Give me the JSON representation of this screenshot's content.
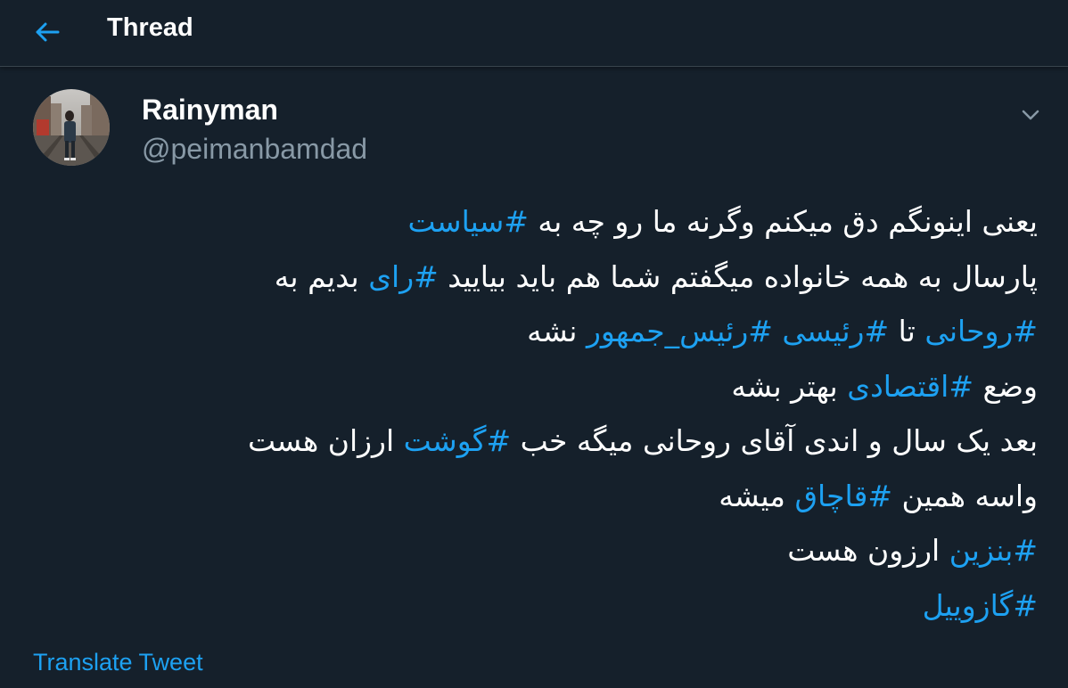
{
  "header": {
    "title": "Thread",
    "back_icon": "arrow-left-icon"
  },
  "tweet": {
    "author": {
      "display_name": "Rainyman",
      "handle": "@peimanbamdad"
    },
    "lines": [
      [
        {
          "t": "یعنی اینونگم دق میکنم وگرنه ما رو چه به "
        },
        {
          "t": "#سیاست",
          "tag": true
        }
      ],
      [
        {
          "t": "پارسال به همه خانواده میگفتم شما هم باید بیایید "
        },
        {
          "t": "#رای",
          "tag": true
        },
        {
          "t": " بدیم به"
        }
      ],
      [
        {
          "t": "#روحانی",
          "tag": true
        },
        {
          "t": " تا "
        },
        {
          "t": "#رئیسی",
          "tag": true
        },
        {
          "t": " "
        },
        {
          "t": "#رئیس_جمهور",
          "tag": true
        },
        {
          "t": " نشه"
        }
      ],
      [
        {
          "t": "وضع "
        },
        {
          "t": "#اقتصادی",
          "tag": true
        },
        {
          "t": " بهتر بشه"
        }
      ],
      [
        {
          "t": "بعد یک سال و اندی آقای روحانی میگه خب "
        },
        {
          "t": "#گوشت",
          "tag": true
        },
        {
          "t": " ارزان هست"
        }
      ],
      [
        {
          "t": "واسه همین "
        },
        {
          "t": "#قاچاق",
          "tag": true
        },
        {
          "t": " میشه"
        }
      ],
      [
        {
          "t": "#بنزین",
          "tag": true
        },
        {
          "t": " ارزون هست"
        }
      ],
      [
        {
          "t": "#گازوییل",
          "tag": true
        }
      ]
    ],
    "translate_label": "Translate Tweet"
  },
  "colors": {
    "background": "#15202b",
    "accent": "#1da1f2",
    "secondary_text": "#8899a6",
    "border": "#38444d"
  },
  "icons": {
    "back": "arrow-left-icon",
    "menu": "chevron-down-icon",
    "avatar": "avatar"
  }
}
